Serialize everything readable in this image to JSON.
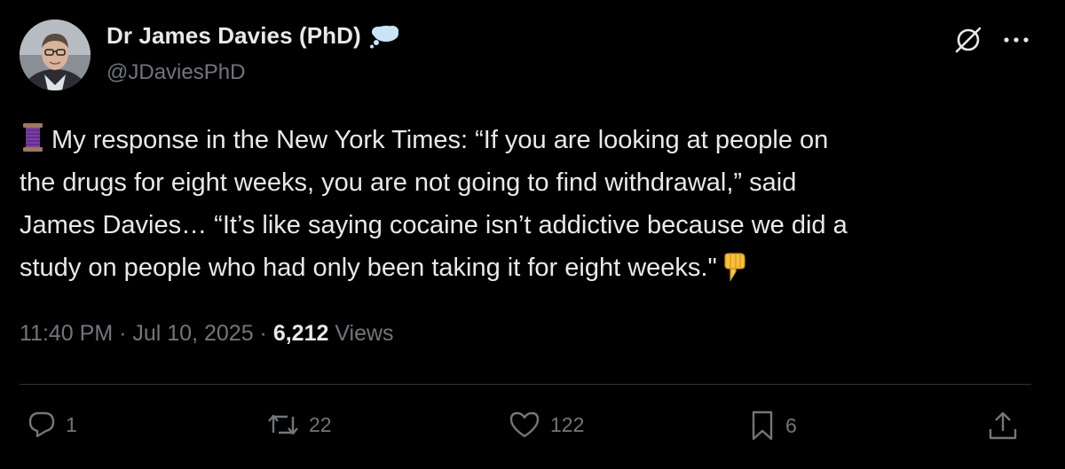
{
  "author": {
    "display_name": "Dr James Davies (PhD)",
    "handle": "@JDaviesPhD",
    "badge_icon": "thought-bubble-icon"
  },
  "top_actions": {
    "grok_icon": "grok-icon",
    "more_icon": "more-icon"
  },
  "post": {
    "leading_emoji": "thread-icon",
    "text_line_1": "My response in the New York Times: “If you are looking at people on",
    "text_line_2": "the drugs for eight weeks, you are not going to find withdrawal,” said",
    "text_line_3": "James Davies… “It’s like saying cocaine isn’t addictive because we did a",
    "text_line_4": "study on people who had only been taking it for eight weeks.\"",
    "trailing_emoji": "backhand-index-pointing-down-icon"
  },
  "meta": {
    "time": "11:40 PM",
    "separator": " · ",
    "date": "Jul 10, 2025",
    "views_count": "6,212",
    "views_label": " Views"
  },
  "actions": {
    "replies": "1",
    "reposts": "22",
    "likes": "122",
    "bookmarks": "6"
  },
  "colors": {
    "background": "#000000",
    "primary_text": "#e7e9ea",
    "secondary_text": "#71767b",
    "divider": "#2f3336",
    "badge": "#c9e4f5"
  }
}
